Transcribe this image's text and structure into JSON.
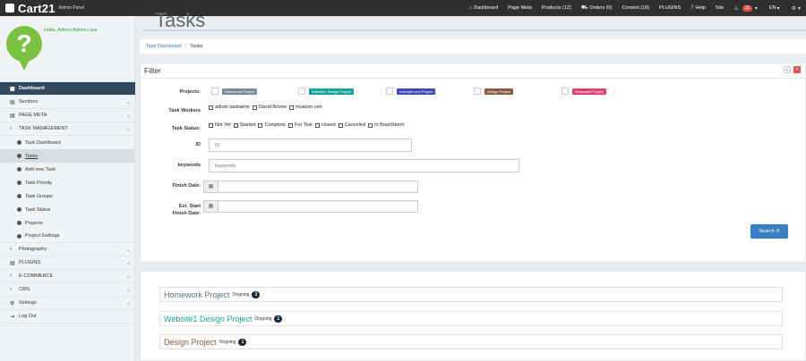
{
  "topbar": {
    "brand": "Cart21",
    "brand_sub": "Admin Panel",
    "nav": [
      {
        "icon": "dashboard-icon",
        "glyph": "⌂",
        "label": "Dashboard"
      },
      {
        "icon": "",
        "glyph": "",
        "label": "Page Meta"
      },
      {
        "icon": "",
        "glyph": "",
        "label": "Products (12)"
      },
      {
        "icon": "cart-icon",
        "glyph": "🛒",
        "label": "Orders (0)"
      },
      {
        "icon": "",
        "glyph": "",
        "label": "Content (18)"
      },
      {
        "icon": "",
        "glyph": "",
        "label": "PLUGINS"
      },
      {
        "icon": "help-icon",
        "glyph": "?",
        "label": "Help"
      },
      {
        "icon": "",
        "glyph": "",
        "label": "Site"
      }
    ],
    "alert_count": "11",
    "language": "EN",
    "settings_glyph": "⚙"
  },
  "sidebar": {
    "hello": "Hello, Admin Admin Last",
    "items": [
      {
        "label": "Dashboard",
        "glyph": "▦"
      },
      {
        "label": "Sections",
        "glyph": "▤"
      },
      {
        "label": "PAGE META",
        "glyph": "▤"
      },
      {
        "label": "TASK MANAGEMENT",
        "glyph": "›"
      },
      {
        "label": "Task Dashboard"
      },
      {
        "label": "Tasks"
      },
      {
        "label": "Add new Task"
      },
      {
        "label": "Task Priority"
      },
      {
        "label": "Task Groups"
      },
      {
        "label": "Task Status"
      },
      {
        "label": "Projects"
      },
      {
        "label": "Project Settings"
      },
      {
        "label": "Photography",
        "glyph": "›"
      },
      {
        "label": "PLUGINS",
        "glyph": "▤"
      },
      {
        "label": "E-COMMERCE",
        "glyph": "›"
      },
      {
        "label": "CMS",
        "glyph": "›"
      },
      {
        "label": "Settings",
        "glyph": "⚙"
      },
      {
        "label": "Log Out",
        "glyph": "⇥"
      }
    ]
  },
  "page": {
    "title": "Tasks",
    "breadcrumb": [
      "Task Dashboard",
      "Tasks"
    ]
  },
  "filter": {
    "title": "Filter",
    "labels": {
      "projects": "Projects:",
      "workers": "Task Workers",
      "status": "Task Status:",
      "id": "ID",
      "keywords": "keywords",
      "finish_date": "Finish Date:",
      "est_start": "Est. Start",
      "est_finish": "Finish Date:"
    },
    "projects": [
      {
        "label": "Homework Project",
        "color": "#7a8b97"
      },
      {
        "label": "Website1 Design Project",
        "color": "#17a2a0"
      },
      {
        "label": "example.com Project",
        "color": "#3f4ab6"
      },
      {
        "label": "Design Project",
        "color": "#8b5a44"
      },
      {
        "label": "Reaseach Project",
        "color": "#e0406f"
      }
    ],
    "workers": [
      "admin lastname",
      "David Brizen",
      "muslum cen"
    ],
    "statuses": [
      "Not Yet",
      "Started",
      "Complete",
      "For Test",
      "closed",
      "Canceled",
      "In BrainStorm"
    ],
    "id_placeholder": "ID",
    "keywords_placeholder": "keywords",
    "search_label": "Search"
  },
  "project_list": [
    {
      "name": "Homework Project",
      "status": "Ongoing",
      "count": "3",
      "color": "#5f6e79"
    },
    {
      "name": "Website1 Design Project",
      "status": "Ongoing",
      "count": "1",
      "color": "#17a2a0"
    },
    {
      "name": "Design Project",
      "status": "Ongoing",
      "count": "1",
      "color": "#8b5a44"
    }
  ]
}
